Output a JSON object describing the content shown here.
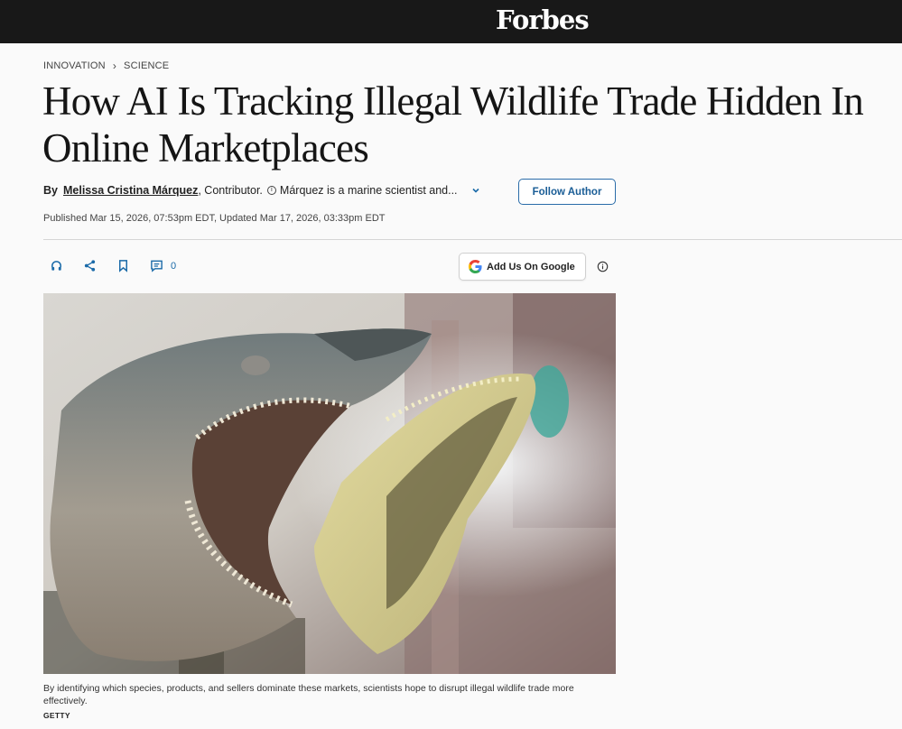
{
  "header": {
    "logo": "Forbes"
  },
  "breadcrumb": {
    "section": "INNOVATION",
    "subsection": "SCIENCE"
  },
  "article": {
    "title": "How AI Is Tracking Illegal Wildlife Trade Hidden In Online Marketplaces",
    "byline_prefix": "By",
    "author": "Melissa Cristina Márquez",
    "contributor_label": ", Contributor.",
    "author_bio": "Márquez is a marine scientist and...",
    "follow_label": "Follow Author",
    "dates": "Published Mar 15, 2026, 07:53pm EDT, Updated Mar 17, 2026, 03:33pm EDT",
    "comment_count": "0"
  },
  "actions": {
    "google_label": "Add Us On Google",
    "icons": [
      "headphones-icon",
      "share-icon",
      "bookmark-icon",
      "comment-icon",
      "info-icon"
    ]
  },
  "image": {
    "description_icon": "shark-jaws-photo",
    "caption": "By identifying which species, products, and sellers dominate these markets, scientists hope to disrupt illegal wildlife trade more effectively.",
    "credit": "GETTY"
  },
  "colors": {
    "topbar": "#181818",
    "accent_blue": "#1a6aa8",
    "background": "#fafafa"
  }
}
